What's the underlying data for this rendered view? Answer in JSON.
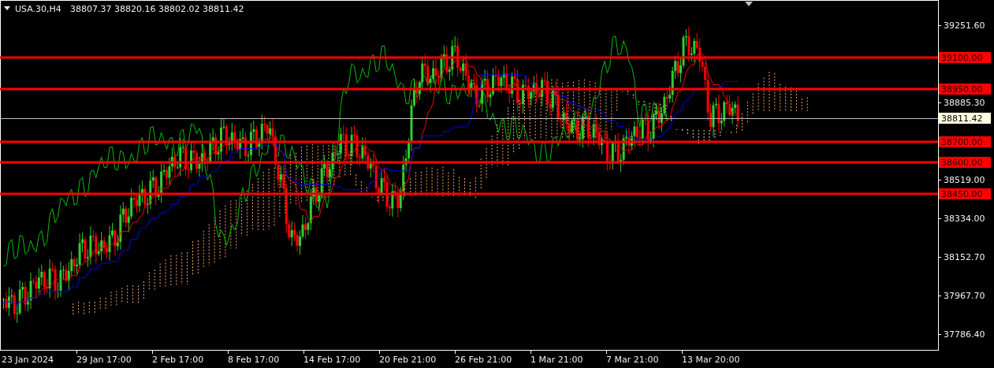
{
  "header": {
    "symbol": "USA.30,H4",
    "ohlc": "38807.37 38820.16 38802.02 38811.42"
  },
  "price_axis": [
    "39251.60",
    "38885.30",
    "38519.00",
    "38334.00",
    "38152.70",
    "37967.70",
    "37786.40"
  ],
  "levels": [
    "39100.00",
    "38950.00",
    "38700.00",
    "38600.00",
    "38450.00"
  ],
  "current_price": "38811.42",
  "time_axis": [
    "23 Jan 2024",
    "29 Jan 17:00",
    "2 Feb 17:00",
    "8 Feb 17:00",
    "14 Feb 17:00",
    "20 Feb 21:00",
    "26 Feb 21:00",
    "1 Mar 21:00",
    "7 Mar 21:00",
    "13 Mar 20:00"
  ]
}
